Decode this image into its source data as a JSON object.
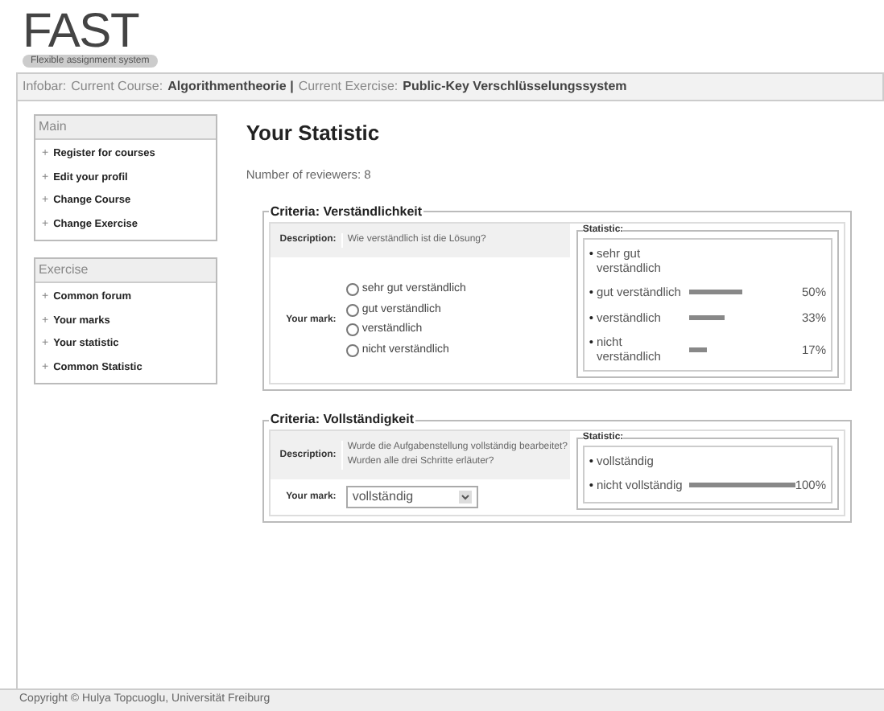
{
  "logo": {
    "title": "FAST",
    "subtitle": "Flexible assignment system"
  },
  "infobar": {
    "label": "Infobar:",
    "course_label": "Current Course:",
    "course": "Algorithmentheorie |",
    "exercise_label": "Current Exercise:",
    "exercise": "Public-Key Verschlüsselungssystem"
  },
  "sidebar": [
    {
      "title": "Main",
      "items": [
        {
          "bullet": "+",
          "label": "Register for courses"
        },
        {
          "bullet": "+",
          "label": "Edit your profil"
        },
        {
          "bullet": "+",
          "label": "Change Course"
        },
        {
          "bullet": "+",
          "label": "Change Exercise"
        }
      ]
    },
    {
      "title": "Exercise",
      "items": [
        {
          "bullet": "+",
          "label": "Common forum"
        },
        {
          "bullet": "+",
          "label": "Your marks"
        },
        {
          "bullet": "+",
          "label": "Your statistic"
        },
        {
          "bullet": "+",
          "label": "Common Statistic"
        }
      ]
    }
  ],
  "page_title": "Your Statistic",
  "reviewers": "Number of reviewers: 8",
  "criteria": [
    {
      "title": "Criteria: Verständlichkeit",
      "description_label": "Description:",
      "description": "Wie verständlich ist die Lösung?",
      "mark_label": "Your mark:",
      "mark": {
        "kind": "radio",
        "options": [
          {
            "label": "sehr gut verständlich",
            "selected": false
          },
          {
            "label": "gut verständlich",
            "selected": false
          },
          {
            "label": "verständlich",
            "selected": false
          },
          {
            "label": "nicht verständlich",
            "selected": false
          }
        ]
      },
      "statistic_title": "Statistic:",
      "statistic": [
        {
          "bullet": "•",
          "label": "sehr gut verständlich"
        },
        {
          "bullet": "•",
          "label": "gut verständlich",
          "percent": "50%"
        },
        {
          "bullet": "•",
          "label": "verständlich",
          "percent": "33%"
        },
        {
          "bullet": "•",
          "label": "nicht verständlich",
          "percent": "17%"
        }
      ]
    },
    {
      "title": "Criteria: Vollständigkeit",
      "description_label": "Description:",
      "description": "Wurde die Aufgabenstellung vollständig bearbeitet? Wurden alle drei Schritte erläuter?",
      "mark_label": "Your mark:",
      "mark": {
        "kind": "select",
        "value": "vollständig"
      },
      "statistic_title": "Statistic:",
      "statistic": [
        {
          "bullet": "•",
          "label": "vollständig"
        },
        {
          "bullet": "•",
          "label": "nicht vollständig",
          "percent": "100%"
        }
      ]
    }
  ],
  "footer": "Copyright © Hulya Topcuoglu, Universität Freiburg"
}
